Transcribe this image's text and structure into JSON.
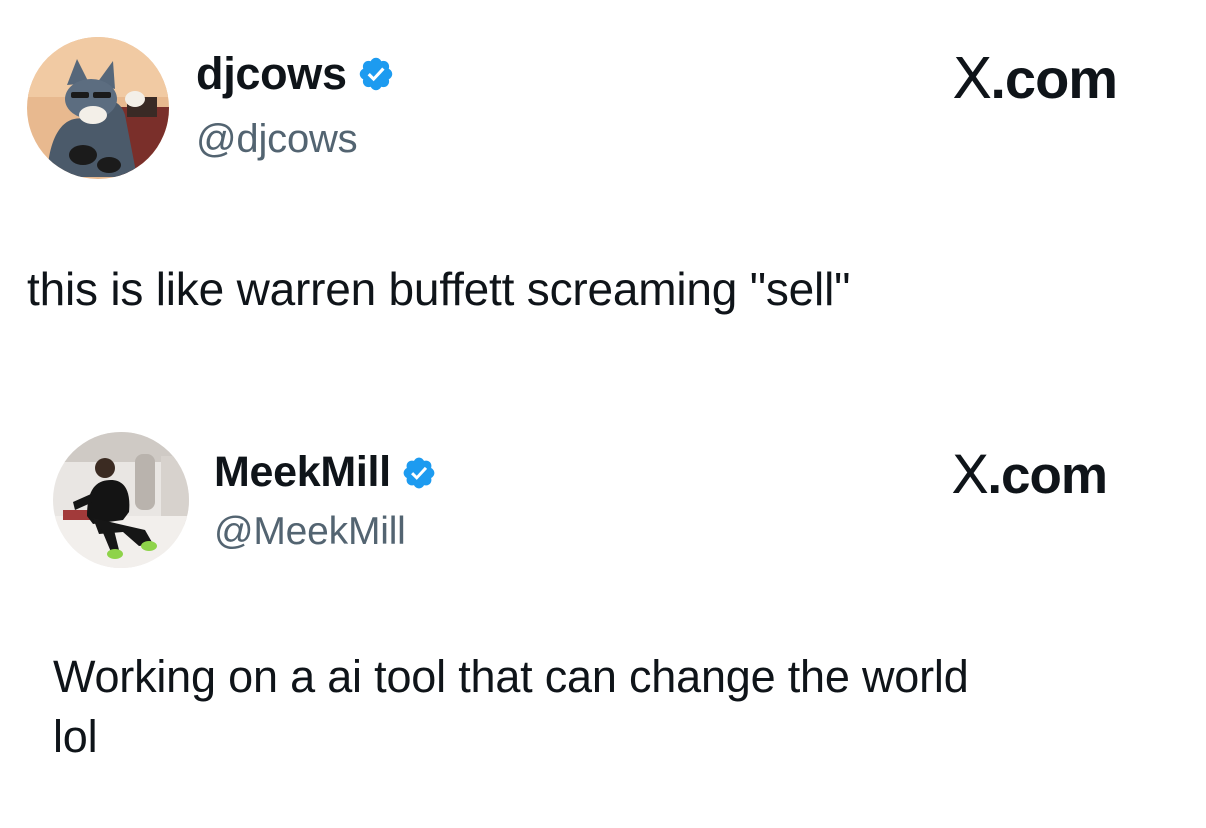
{
  "tweet": {
    "display_name": "djcows",
    "handle": "@djcows",
    "brand": {
      "glyph": "X",
      "suffix": ".com"
    },
    "verified_icon": "verified-badge-icon",
    "avatar_icon": "cartoon-cat-avatar",
    "text": "this is like warren buffett screaming \"sell\""
  },
  "quoted_tweet": {
    "display_name": "MeekMill",
    "handle": "@MeekMill",
    "brand": {
      "glyph": "X",
      "suffix": ".com"
    },
    "verified_icon": "verified-badge-icon",
    "avatar_icon": "person-photo-avatar",
    "text": "Working on a ai tool that can change the world\nlol"
  },
  "colors": {
    "verified_blue": "#1d9bf0",
    "text_primary": "#0f1419",
    "text_secondary": "#536471",
    "background": "#ffffff"
  }
}
